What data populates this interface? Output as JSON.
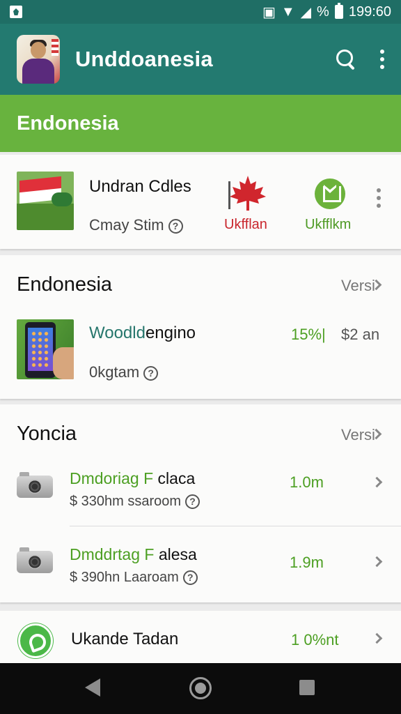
{
  "status_bar": {
    "percent": "%",
    "time": "199:60"
  },
  "app_bar": {
    "title": "Unddoanesia"
  },
  "banner": {
    "title": "Endonesia"
  },
  "featured": {
    "title": "Undran Cdles",
    "subtitle": "Cmay Stim",
    "action1_label": "Ukfflan",
    "action2_label": "Ukfflkm"
  },
  "section1": {
    "title": "Endonesia",
    "link": "Versi",
    "item": {
      "name_part1": "Woodld",
      "name_part2": "engino",
      "subtitle": "0kgtam",
      "percent": "15%|",
      "price": "$2 an"
    }
  },
  "section2": {
    "title": "Yoncia",
    "link": "Versi",
    "items": [
      {
        "name_part1": "Dmdoriag F",
        "name_part2": " claca",
        "subtitle": "$ 330hm ssaroom",
        "value": "1.0m"
      },
      {
        "name_part1": "Dmddrtag F",
        "name_part2": " alesa",
        "subtitle": "$ 390hn Laaroam",
        "value": "1.9m"
      }
    ]
  },
  "bottom_item": {
    "name": "Ukande Tadan",
    "value": "1 0%nt"
  },
  "colors": {
    "appbar": "#237a70",
    "banner": "#68b33e",
    "accent_green": "#4c9f22",
    "flag_red": "#c9262d"
  },
  "icons": [
    "search-icon",
    "more-icon",
    "help-icon",
    "maple-leaf-icon",
    "download-badge-icon",
    "camera-icon",
    "whatsapp-icon",
    "chevron-right-icon"
  ]
}
